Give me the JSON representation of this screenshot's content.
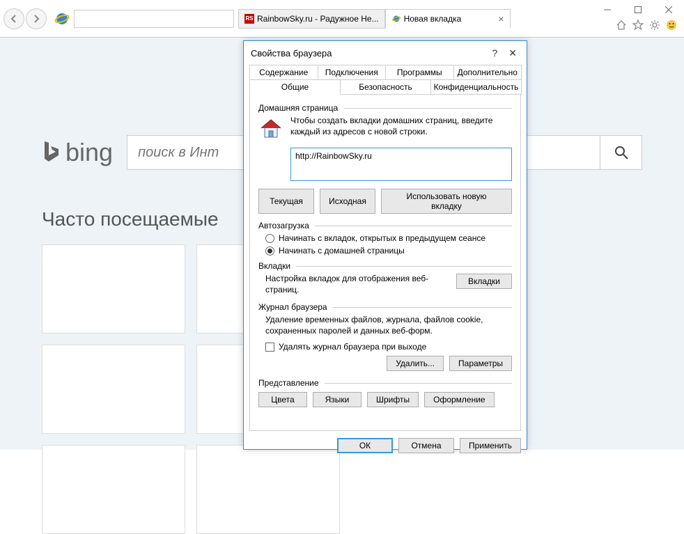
{
  "tabs": [
    {
      "title": "RainbowSky.ru - Радужное Не..."
    },
    {
      "title": "Новая вкладка"
    }
  ],
  "bing": {
    "logo": "bing",
    "placeholder": "поиск в Инт"
  },
  "page": {
    "frequent_title": "Часто посещаемые"
  },
  "dialog": {
    "title": "Свойства браузера",
    "tabs_row1": [
      "Содержание",
      "Подключения",
      "Программы",
      "Дополнительно"
    ],
    "tabs_row2": [
      "Общие",
      "Безопасность",
      "Конфиденциальность"
    ],
    "homepage": {
      "legend": "Домашняя страница",
      "desc": "Чтобы создать вкладки домашних страниц, введите каждый из адресов с новой строки.",
      "url": "http://RainbowSky.ru",
      "btn_current": "Текущая",
      "btn_default": "Исходная",
      "btn_newtab": "Использовать новую вкладку"
    },
    "startup": {
      "legend": "Автозагрузка",
      "opt_previous": "Начинать с вкладок, открытых в предыдущем сеансе",
      "opt_home": "Начинать с домашней страницы"
    },
    "tabs_section": {
      "legend": "Вкладки",
      "desc": "Настройка вкладок для отображения веб-страниц.",
      "btn": "Вкладки"
    },
    "history": {
      "legend": "Журнал браузера",
      "desc": "Удаление временных файлов, журнала, файлов cookie, сохраненных паролей и данных веб-форм.",
      "check": "Удалять журнал браузера при выходе",
      "btn_delete": "Удалить...",
      "btn_params": "Параметры"
    },
    "presentation": {
      "legend": "Представление",
      "btn_colors": "Цвета",
      "btn_langs": "Языки",
      "btn_fonts": "Шрифты",
      "btn_style": "Оформление"
    },
    "footer": {
      "ok": "ОК",
      "cancel": "Отмена",
      "apply": "Применить"
    }
  }
}
